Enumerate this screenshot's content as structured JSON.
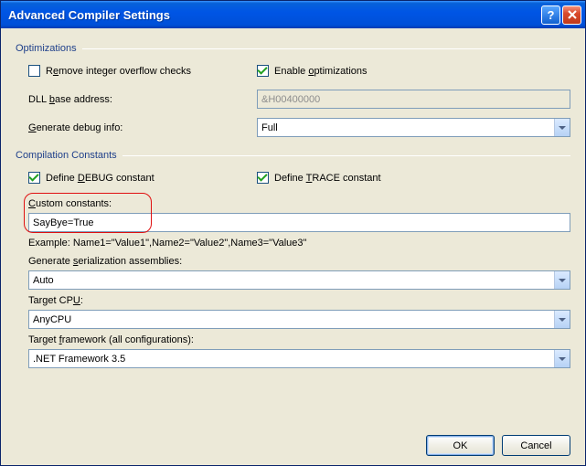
{
  "window": {
    "title": "Advanced Compiler Settings"
  },
  "groups": {
    "optimizations": {
      "header": "Optimizations",
      "remove_overflow_prefix": "R",
      "remove_overflow_underline": "e",
      "remove_overflow_suffix": "move integer overflow checks",
      "enable_opt_prefix": "Enable ",
      "enable_opt_underline": "o",
      "enable_opt_suffix": "ptimizations",
      "dll_base_prefix": "DLL ",
      "dll_base_underline": "b",
      "dll_base_suffix": "ase address:",
      "dll_base_value": "&H00400000",
      "gen_debug_prefix": "",
      "gen_debug_underline": "G",
      "gen_debug_suffix": "enerate debug info:",
      "gen_debug_value": "Full"
    },
    "compilation": {
      "header": "Compilation Constants",
      "define_debug_prefix": "Define ",
      "define_debug_underline": "D",
      "define_debug_suffix": "EBUG constant",
      "define_trace_prefix": "Define ",
      "define_trace_underline": "T",
      "define_trace_suffix": "RACE constant",
      "custom_constants_prefix": "",
      "custom_constants_underline": "C",
      "custom_constants_suffix": "ustom constants:",
      "custom_constants_value": "SayBye=True",
      "example_text": "Example: Name1=\"Value1\",Name2=\"Value2\",Name3=\"Value3\"",
      "gen_serial_prefix": "Generate ",
      "gen_serial_underline": "s",
      "gen_serial_suffix": "erialization assemblies:",
      "gen_serial_value": "Auto",
      "target_cpu_prefix": "Target CP",
      "target_cpu_underline": "U",
      "target_cpu_suffix": ":",
      "target_cpu_value": "AnyCPU",
      "target_fw_prefix": "Target ",
      "target_fw_underline": "f",
      "target_fw_suffix": "ramework (all configurations):",
      "target_fw_value": ".NET Framework 3.5"
    }
  },
  "buttons": {
    "ok": "OK",
    "cancel": "Cancel"
  }
}
